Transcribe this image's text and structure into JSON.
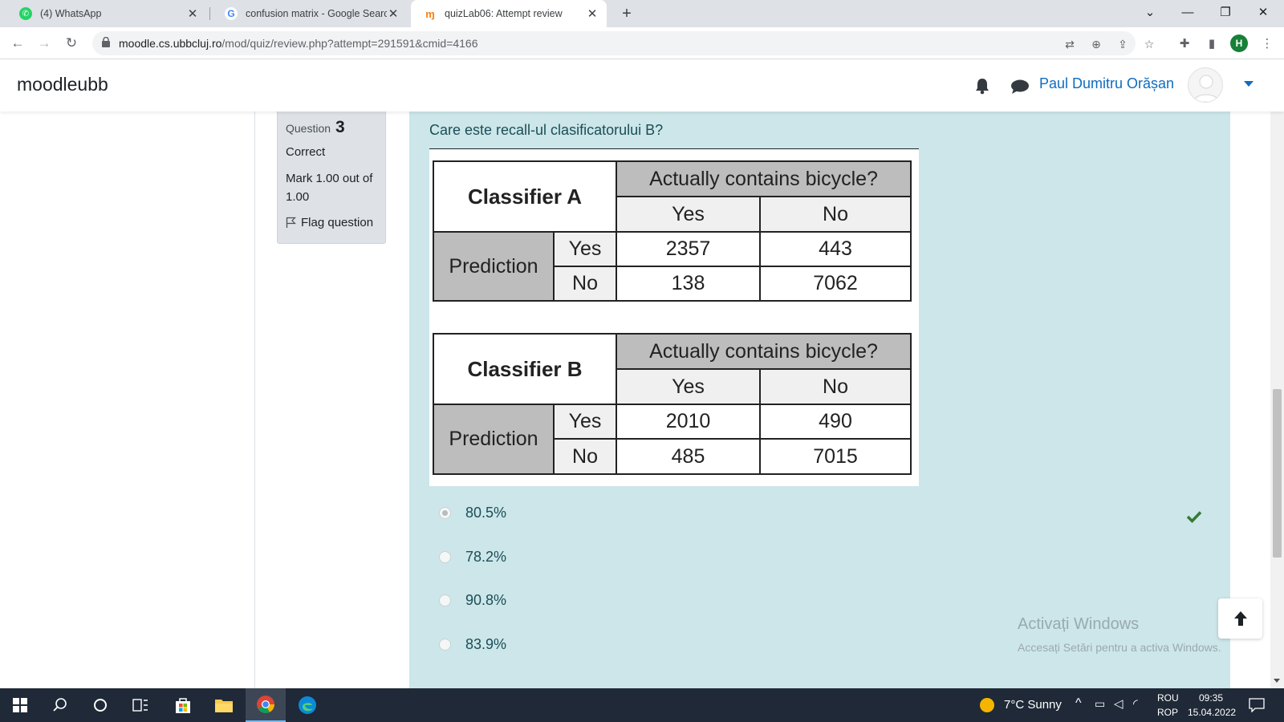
{
  "browser": {
    "tabs": [
      {
        "title": "(4) WhatsApp",
        "active": false
      },
      {
        "title": "confusion matrix - Google Search",
        "active": false
      },
      {
        "title": "quizLab06: Attempt review",
        "active": true
      }
    ],
    "url_host": "moodle.cs.ubbcluj.ro",
    "url_path": "/mod/quiz/review.php?attempt=291591&cmid=4166",
    "profile_initial": "H"
  },
  "moodle": {
    "brand": "moodleubb",
    "user_name": "Paul Dumitru Orășan"
  },
  "question_info": {
    "label": "Question",
    "number": "3",
    "state": "Correct",
    "grade_line1": "Mark 1.00 out of",
    "grade_line2": "1.00",
    "flag_label": "Flag question"
  },
  "question": {
    "text": "Care este recall-ul clasificatorului B?",
    "tables": [
      {
        "classifier": "Classifier A",
        "header": "Actually contains bicycle?",
        "col_yes": "Yes",
        "col_no": "No",
        "row_label": "Prediction",
        "row_yes": "Yes",
        "row_no": "No",
        "tp": "2357",
        "fp": "443",
        "fn": "138",
        "tn": "7062"
      },
      {
        "classifier": "Classifier B",
        "header": "Actually contains bicycle?",
        "col_yes": "Yes",
        "col_no": "No",
        "row_label": "Prediction",
        "row_yes": "Yes",
        "row_no": "No",
        "tp": "2010",
        "fp": "490",
        "fn": "485",
        "tn": "7015"
      }
    ],
    "answers": [
      {
        "label": "80.5%",
        "selected": true,
        "correct": true
      },
      {
        "label": "78.2%",
        "selected": false
      },
      {
        "label": "90.8%",
        "selected": false
      },
      {
        "label": "83.9%",
        "selected": false
      }
    ]
  },
  "watermark": {
    "line1": "Activați Windows",
    "line2": "Accesați Setări pentru a activa Windows."
  },
  "taskbar": {
    "weather": "7°C  Sunny",
    "lang1": "ROU",
    "lang2": "ROP",
    "time": "09:35",
    "date": "15.04.2022"
  },
  "colors": {
    "accent": "#0f6cbf",
    "question_bg": "#cce6ea",
    "correct_tick": "#357a32"
  }
}
